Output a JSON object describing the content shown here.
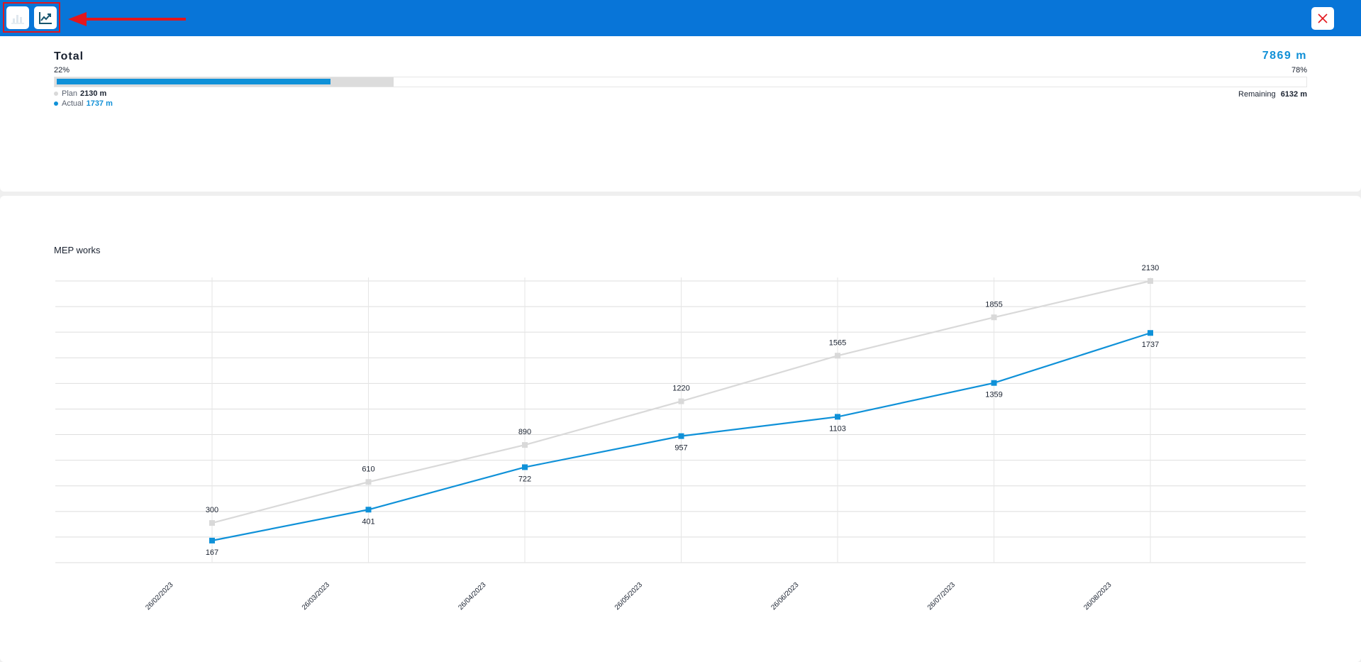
{
  "toolbar": {
    "bar_view_icon": "bar-chart-icon",
    "line_view_icon": "line-chart-icon",
    "close_icon": "close-icon",
    "accent_color": "#0875d8",
    "annotation_color": "#e3161c"
  },
  "summary": {
    "title": "Total",
    "total_value": "7869 m",
    "completed_percent": "22%",
    "remaining_percent": "78%",
    "plan_label": "Plan",
    "plan_value": "2130 m",
    "actual_label": "Actual",
    "actual_value": "1737 m",
    "remaining_label": "Remaining",
    "remaining_value": "6132 m",
    "progress": {
      "total": 7869,
      "plan": 2130,
      "actual": 1737
    }
  },
  "chart_data": {
    "type": "line",
    "title": "MEP works",
    "xlabel": "",
    "ylabel": "",
    "x": [
      "26/02/2023",
      "26/03/2023",
      "26/04/2023",
      "26/05/2023",
      "26/06/2023",
      "26/07/2023",
      "26/08/2023"
    ],
    "ylim": [
      0,
      2130
    ],
    "grid": true,
    "series": [
      {
        "key": "plan",
        "color": "#d9d9d9",
        "values": [
          300,
          610,
          890,
          1220,
          1565,
          1855,
          2130
        ]
      },
      {
        "key": "actual",
        "color": "#0f91d8",
        "values": [
          167,
          401,
          722,
          957,
          1103,
          1359,
          1737
        ]
      }
    ]
  }
}
